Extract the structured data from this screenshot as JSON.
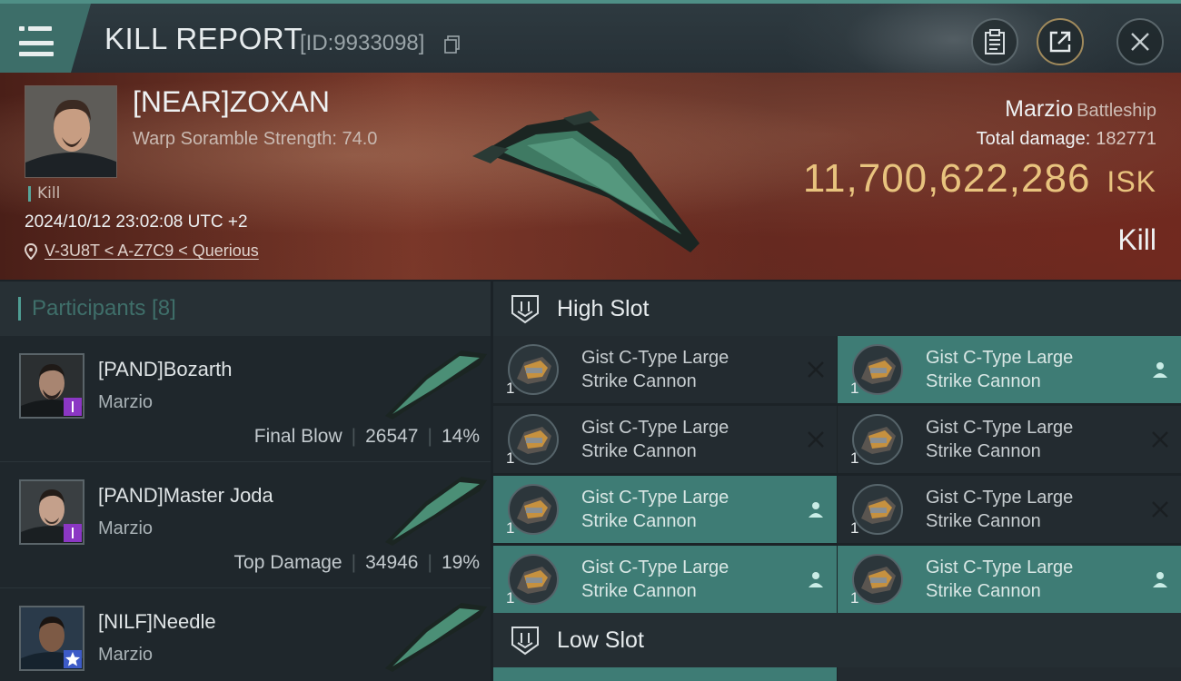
{
  "header": {
    "title": "KILL REPORT",
    "report_id": "[ID:9933098]"
  },
  "victim": {
    "name": "[NEAR]ZOXAN",
    "subtitle": "Warp Soramble Strength: 74.0",
    "tag": "Kill",
    "timestamp": "2024/10/12 23:02:08 UTC +2",
    "location": "V-3U8T < A-Z7C9 < Querious",
    "ship": "Marzio",
    "ship_class": "Battleship",
    "total_damage_label": "Total damage:",
    "total_damage": "182771",
    "isk_value": "11,700,622,286",
    "isk_unit": "ISK",
    "kill_type": "Kill"
  },
  "participants": {
    "title": "Participants [8]",
    "rows": [
      {
        "name": "[PAND]Bozarth",
        "ship": "Marzio",
        "role": "Final Blow",
        "damage": "26547",
        "percent": "14%",
        "badge": "purple"
      },
      {
        "name": "[PAND]Master Joda",
        "ship": "Marzio",
        "role": "Top Damage",
        "damage": "34946",
        "percent": "19%",
        "badge": "purple"
      },
      {
        "name": "[NILF]Needle",
        "ship": "Marzio",
        "role": "",
        "damage": "",
        "percent": "",
        "badge": "blue"
      }
    ]
  },
  "slots": {
    "high_slot_label": "High Slot",
    "low_slot_label": "Low Slot",
    "high_modules": [
      {
        "line1": "Gist C-Type Large",
        "line2": "Strike Cannon",
        "qty": "1",
        "status": "destroyed"
      },
      {
        "line1": "Gist C-Type Large",
        "line2": "Strike Cannon",
        "qty": "1",
        "status": "dropped"
      },
      {
        "line1": "Gist C-Type Large",
        "line2": "Strike Cannon",
        "qty": "1",
        "status": "destroyed"
      },
      {
        "line1": "Gist C-Type Large",
        "line2": "Strike Cannon",
        "qty": "1",
        "status": "destroyed"
      },
      {
        "line1": "Gist C-Type Large",
        "line2": "Strike Cannon",
        "qty": "1",
        "status": "dropped"
      },
      {
        "line1": "Gist C-Type Large",
        "line2": "Strike Cannon",
        "qty": "1",
        "status": "destroyed"
      },
      {
        "line1": "Gist C-Type Large",
        "line2": "Strike Cannon",
        "qty": "1",
        "status": "dropped"
      },
      {
        "line1": "Gist C-Type Large",
        "line2": "Strike Cannon",
        "qty": "1",
        "status": "dropped"
      }
    ]
  },
  "colors": {
    "accent_teal": "#3e7c75",
    "isk_gold": "#e8c37e",
    "badge_purple": "#8b37c4",
    "badge_blue": "#3d5bc7"
  },
  "icons": [
    "menu-icon",
    "copy-icon",
    "clipboard-icon",
    "export-icon",
    "close-icon",
    "location-pin-icon",
    "high-slot-icon",
    "low-slot-icon",
    "destroyed-x-icon",
    "dropped-person-icon"
  ]
}
